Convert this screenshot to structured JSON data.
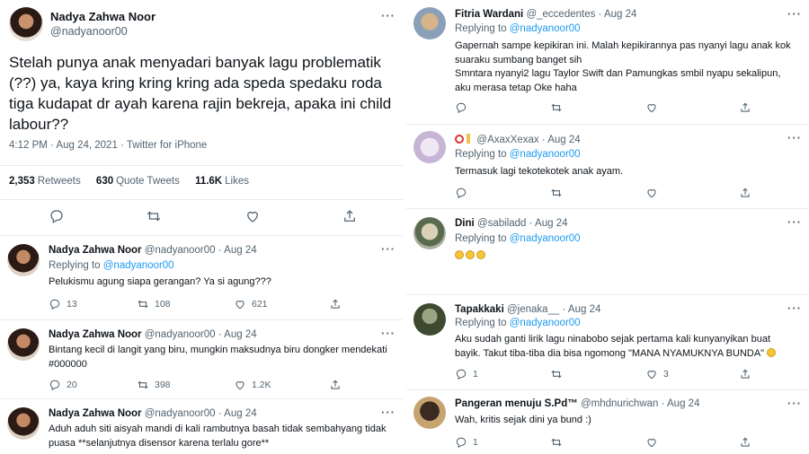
{
  "main_tweet": {
    "name": "Nadya Zahwa Noor",
    "handle": "@nadyanoor00",
    "text": "Stelah punya anak menyadari banyak lagu problematik (??) ya, kaya kring kring kring ada speda spedaku roda tiga kudapat dr ayah karena rajin bekreja, apaka ini child labour??",
    "meta": "4:12 PM · Aug 24, 2021 · Twitter for iPhone",
    "retweets_count": "2,353",
    "retweets_label": "Retweets",
    "quotes_count": "630",
    "quotes_label": "Quote Tweets",
    "likes_count": "11.6K",
    "likes_label": "Likes"
  },
  "left_replies": [
    {
      "name": "Nadya Zahwa Noor",
      "handle": "@nadyanoor00",
      "date": "Aug 24",
      "replying_prefix": "Replying to",
      "replying_to": "@nadyanoor00",
      "text": "Pelukismu agung siapa gerangan? Ya si agung???",
      "replies": "13",
      "retweets": "108",
      "likes": "621",
      "avatar": "profile-photo"
    },
    {
      "name": "Nadya Zahwa Noor",
      "handle": "@nadyanoor00",
      "date": "Aug 24",
      "text": "Bintang kecil di langit yang biru, mungkin maksudnya biru dongker mendekati #000000",
      "replies": "20",
      "retweets": "398",
      "likes": "1.2K",
      "avatar": "profile-photo"
    },
    {
      "name": "Nadya Zahwa Noor",
      "handle": "@nadyanoor00",
      "date": "Aug 24",
      "text": "Aduh aduh siti aisyah mandi di kali rambutnya basah tidak sembahyang tidak puasa **selanjutnya disensor karena terlalu gore**",
      "avatar": "profile-photo"
    }
  ],
  "right_replies": [
    {
      "name": "Fitria Wardani",
      "handle": "@_eccedentes",
      "date": "Aug 24",
      "replying_prefix": "Replying to",
      "replying_to": "@nadyanoor00",
      "text": "Gapernah sampe kepikiran ini. Malah kepikirannya pas nyanyi lagu anak kok suaraku sumbang banget sih\nSmntara nyanyi2 lagu Taylor Swift dan Pamungkas smbil nyapu sekalipun, aku merasa tetap Oke haha",
      "replies": "",
      "retweets": "",
      "likes": ""
    },
    {
      "name": "",
      "name_icons": "circle-and-candle-emoji",
      "handle": "@AxaxXexax",
      "date": "Aug 24",
      "replying_prefix": "Replying to",
      "replying_to": "@nadyanoor00",
      "text": "Termasuk lagi tekotekotek anak ayam.",
      "replies": "",
      "retweets": "",
      "likes": ""
    },
    {
      "name": "Dini",
      "handle": "@sabiladd",
      "date": "Aug 24",
      "replying_prefix": "Replying to",
      "replying_to": "@nadyanoor00",
      "text": "",
      "emoji_count": 3
    },
    {
      "name": "Tapakkaki",
      "handle": "@jenaka__",
      "date": "Aug 24",
      "replying_prefix": "Replying to",
      "replying_to": "@nadyanoor00",
      "text": "Aku sudah ganti lirik lagu ninabobo sejak pertama kali kunyanyikan buat bayik. Takut tiba-tiba dia bisa ngomong \"MANA NYAMUKNYA BUNDA\"",
      "replies": "1",
      "retweets": "",
      "likes": "3"
    },
    {
      "name": "Pangeran menuju S.Pd™",
      "handle": "@mhdnurichwan",
      "date": "Aug 24",
      "text": "Wah, kritis sejak dini ya bund :)",
      "replies": "1",
      "retweets": "",
      "likes": ""
    }
  ],
  "icons": [
    "reply-icon",
    "retweet-icon",
    "like-icon",
    "share-icon",
    "more-icon"
  ],
  "colors": {
    "link": "#1d9bf0",
    "muted": "#536471",
    "text": "#0f1419",
    "divider": "#e6ecf0"
  }
}
